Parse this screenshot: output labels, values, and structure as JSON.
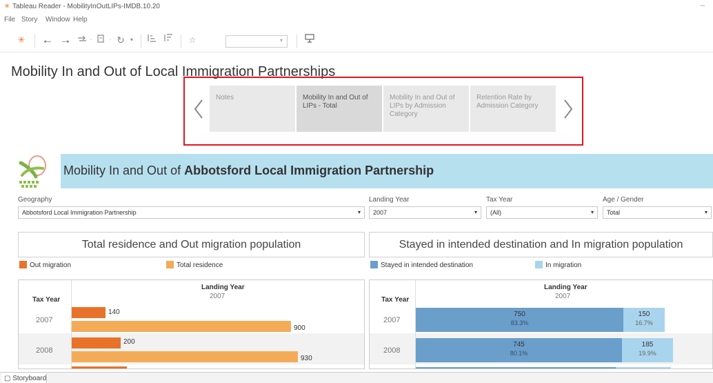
{
  "window": {
    "title": "Tableau Reader - MobilityInOutLIPs-IMDB.10.20",
    "minimize": "–"
  },
  "menu": [
    "File",
    "Story",
    "Window",
    "Help"
  ],
  "toolbar": {
    "icons": [
      "tableau-logo-icon",
      "back-icon",
      "forward-icon",
      "swap-icon",
      "dropdown-icon",
      "data-icon",
      "dropdown-icon",
      "refresh-icon",
      "dropdown-icon",
      "sort-asc-icon",
      "sort-desc-icon",
      "pin-icon",
      "presentation-icon"
    ],
    "caret": "▾"
  },
  "story": {
    "title": "Mobility In and Out of Local Immigration Partnerships",
    "points": [
      {
        "label": "Notes",
        "active": false
      },
      {
        "label": "Mobility In and Out of LIPs - Total",
        "active": true
      },
      {
        "label": "Mobility In and Out of LIPs by Admission Category",
        "active": false
      },
      {
        "label": "Retention Rate by Admission Category",
        "active": false
      }
    ]
  },
  "banner": {
    "prefix": "Mobility In and Out of ",
    "place": "Abbotsford Local Immigration Partnership"
  },
  "filters": {
    "geography": {
      "label": "Geography",
      "value": "Abbotsford Local Immigration Partnership"
    },
    "landing_year": {
      "label": "Landing Year",
      "value": "2007"
    },
    "tax_year": {
      "label": "Tax Year",
      "value": "(All)"
    },
    "age_gender": {
      "label": "Age / Gender",
      "value": "Total"
    },
    "caret": "▾"
  },
  "left_panel": {
    "title": "Total residence and Out migration population",
    "legend": [
      {
        "name": "Out migration",
        "color": "#e8722a"
      },
      {
        "name": "Total residence",
        "color": "#f4ab58"
      }
    ],
    "row_header": "Tax Year",
    "col_header": "Landing Year",
    "col_sub": "2007"
  },
  "right_panel": {
    "title": "Stayed in intended destination and In migration population",
    "legend": [
      {
        "name": "Stayed in intended destination",
        "color": "#6a9ecb"
      },
      {
        "name": "In migration",
        "color": "#a9d4ee"
      }
    ],
    "row_header": "Tax Year",
    "col_header": "Landing Year",
    "col_sub": "2007"
  },
  "chart_data": [
    {
      "type": "bar",
      "title": "Total residence and Out migration population",
      "categories": [
        "2007",
        "2008"
      ],
      "series": [
        {
          "name": "Out migration",
          "values": [
            140,
            200
          ]
        },
        {
          "name": "Total residence",
          "values": [
            900,
            930
          ]
        }
      ],
      "xlabel": "Landing Year",
      "ylabel": "Tax Year"
    },
    {
      "type": "bar",
      "title": "Stayed in intended destination and In migration population",
      "categories": [
        "2007",
        "2008"
      ],
      "series": [
        {
          "name": "Stayed in intended destination",
          "values": [
            750,
            745
          ],
          "pct": [
            "83.3%",
            "80.1%"
          ]
        },
        {
          "name": "In migration",
          "values": [
            150,
            185
          ],
          "pct": [
            "16.7%",
            "19.9%"
          ]
        }
      ],
      "xlabel": "Landing Year",
      "ylabel": "Tax Year"
    }
  ],
  "status": {
    "tab": "Storyboard"
  }
}
